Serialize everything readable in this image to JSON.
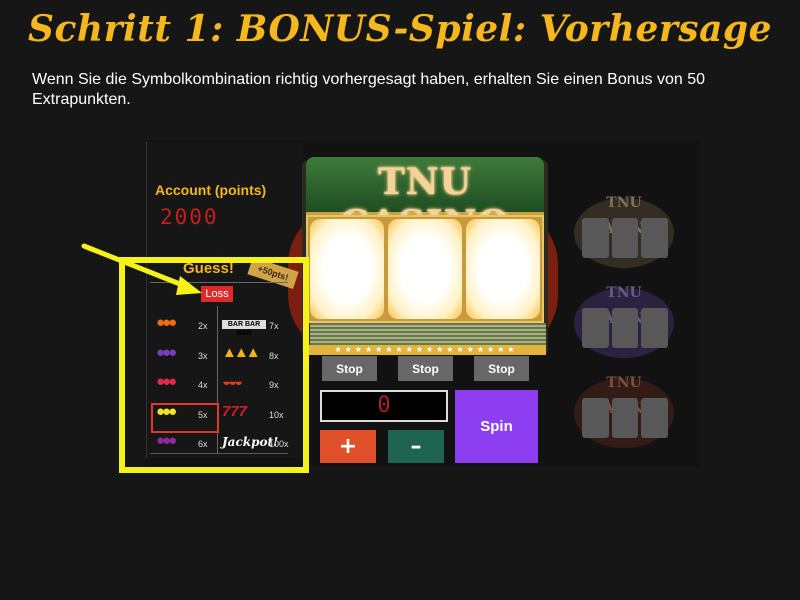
{
  "header": {
    "title": "Schritt 1: BONUS-Spiel: Vorhersage",
    "description": "Wenn Sie die Symbolkombination richtig vorhergesagt haben, erhalten Sie einen Bonus von 50 Extrapunkten."
  },
  "account": {
    "label": "Account (points)",
    "value": "2000"
  },
  "machine": {
    "brand": "TNU CASINO",
    "stop_buttons": [
      "Stop",
      "Stop",
      "Stop"
    ],
    "bet_value": "0",
    "plus_label": "+",
    "minus_label": "–",
    "spin_label": "Spin",
    "lights": "★★★★★★★★★★★★★★★★★★"
  },
  "guess": {
    "title": "Guess!",
    "ribbon": "+50pts!",
    "loss_label": "Loss",
    "left_column": [
      {
        "symbol": "orange",
        "icon": "●●●",
        "color": "#f06a12",
        "multiplier": "2x"
      },
      {
        "symbol": "grapes",
        "icon": "●●●",
        "color": "#7b3cc0",
        "multiplier": "3x"
      },
      {
        "symbol": "cherry",
        "icon": "●●●",
        "color": "#e02a4a",
        "multiplier": "4x"
      },
      {
        "symbol": "lemon",
        "icon": "●●●",
        "color": "#f4e41c",
        "multiplier": "5x"
      },
      {
        "symbol": "plum",
        "icon": "●●●",
        "color": "#8a2a9e",
        "multiplier": "6x"
      }
    ],
    "right_column": [
      {
        "symbol": "bar",
        "icon": "BAR BAR BAR",
        "color": "#dddddd",
        "multiplier": "7x"
      },
      {
        "symbol": "bell",
        "icon": "▲▲▲",
        "color": "#f2b21c",
        "multiplier": "8x"
      },
      {
        "symbol": "watermelon",
        "icon": "◒◒◒",
        "color": "#e03a2a",
        "multiplier": "9x"
      },
      {
        "symbol": "seven",
        "icon": "777",
        "color": "#d0202a",
        "multiplier": "10x"
      },
      {
        "symbol": "jackpot",
        "icon": "Jackpot!",
        "color": "#ffffff",
        "multiplier": "100x"
      }
    ],
    "selected_symbol": "lemon"
  },
  "side_machines": [
    {
      "brand": "TNU CASINO",
      "color": "#c8b08a"
    },
    {
      "brand": "TNU CASINO",
      "color": "#a58ad8"
    },
    {
      "brand": "TNU CASINO",
      "color": "#c67a5a"
    }
  ],
  "colors": {
    "accent_gold": "#f5b81c",
    "highlight_yellow": "#f5f21a",
    "spin_purple": "#8d3ef0"
  }
}
